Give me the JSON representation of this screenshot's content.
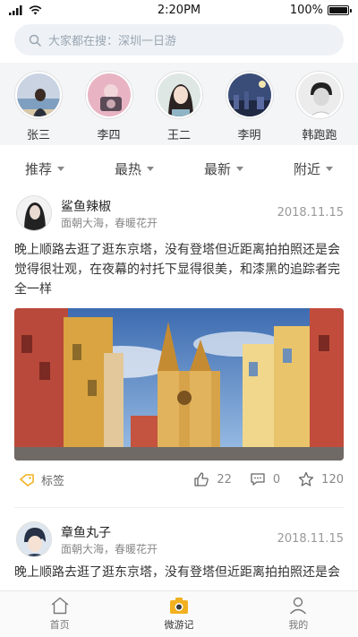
{
  "status": {
    "time": "2:20PM",
    "battery": "100%",
    "battery_level": 1.0
  },
  "search": {
    "placeholder": "大家都在搜：深圳一日游"
  },
  "friends": [
    {
      "name": "张三",
      "icon": "avatar-woman-beach"
    },
    {
      "name": "李四",
      "icon": "avatar-pink-camera"
    },
    {
      "name": "王二",
      "icon": "avatar-girl-portrait"
    },
    {
      "name": "李明",
      "icon": "avatar-night-city"
    },
    {
      "name": "韩跑跑",
      "icon": "avatar-man-bw"
    }
  ],
  "filters": [
    "推荐",
    "最热",
    "最新",
    "附近"
  ],
  "posts": [
    {
      "user": "鲨鱼辣椒",
      "subtitle": "面朝大海，春暖花开",
      "date": "2018.11.15",
      "text": "晚上顺路去逛了逛东京塔，没有登塔但近距离拍拍照还是会觉得很壮观，在夜幕的衬托下显得很美，和漆黑的追踪者完全一样",
      "tag": "标签",
      "likes": "22",
      "comments": "0",
      "favorites": "120"
    },
    {
      "user": "章鱼丸子",
      "subtitle": "面朝大海，春暖花开",
      "date": "2018.11.15",
      "text": "晚上顺路去逛了逛东京塔，没有登塔但近距离拍拍照还是会"
    }
  ],
  "nav": [
    {
      "label": "首页",
      "icon": "home-icon"
    },
    {
      "label": "微游记",
      "icon": "camera-icon"
    },
    {
      "label": "我的",
      "icon": "user-icon"
    }
  ],
  "colors": {
    "accent": "#f2b01e",
    "search_bg": "#eef2f6",
    "strip_bg": "#f4f5f7"
  }
}
